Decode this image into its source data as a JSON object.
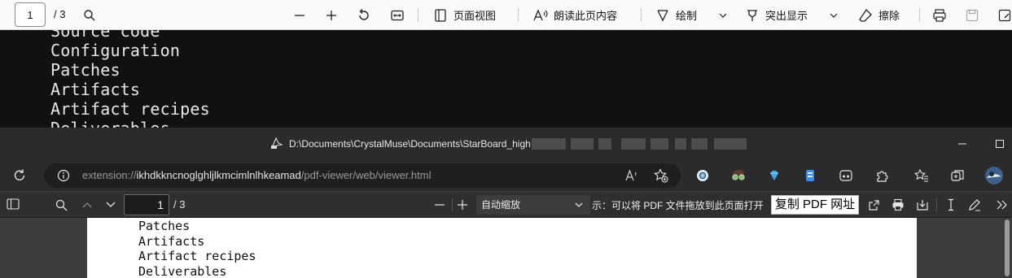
{
  "bg_viewer": {
    "page_current": "1",
    "page_total": "/ 3",
    "page_view_label": "页面视图",
    "read_aloud_label": "朗读此页内容",
    "draw_label": "绘制",
    "highlight_label": "突出显示",
    "erase_label": "擦除",
    "doc_lines": [
      "Source code",
      "Configuration",
      "Patches",
      "Artifacts",
      "Artifact recipes",
      "Deliverables"
    ]
  },
  "window": {
    "title": "D:\\Documents\\CrystalMuse\\Documents\\StarBoard_high"
  },
  "address_bar": {
    "url_prefix": "extension://",
    "url_host": "ikhdkkncnoglghljlkmcimlnlhkeamad",
    "url_path": "/pdf-viewer/web/viewer.html"
  },
  "pdf_toolbar": {
    "page_current": "1",
    "page_total": "/ 3",
    "zoom_value": "自动缩放",
    "hint": "示：可以将 PDF 文件拖放到此页面打开",
    "copy_button": "复制 PDF 网址"
  },
  "page_content": {
    "lines": [
      "Patches",
      "Artifacts",
      "Artifact recipes",
      "Deliverables"
    ]
  },
  "icons": {
    "search": "search-icon",
    "zoom_out": "minus-icon",
    "zoom_in": "plus-icon",
    "rotate": "rotate-icon",
    "fit": "fit-width-icon",
    "page_view": "page-view-icon",
    "read_aloud": "read-aloud-icon",
    "draw": "draw-icon",
    "highlight": "highlight-icon",
    "erase": "eraser-icon",
    "print": "print-icon",
    "save": "save-icon",
    "save_as": "save-as-icon",
    "refresh": "refresh-icon",
    "info": "info-icon",
    "minimize": "minimize-icon",
    "maximize": "maximize-icon"
  },
  "colors": {
    "accent": "#0078d4",
    "dark_bg": "#202020",
    "toolbar_light": "#f9f9f9"
  }
}
